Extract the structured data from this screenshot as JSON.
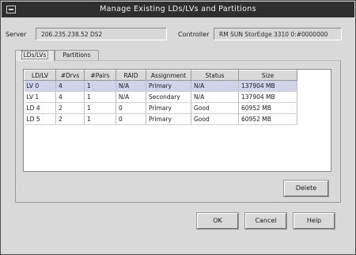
{
  "window": {
    "title": "Manage Existing LDs/LVs and Partitions"
  },
  "server": {
    "label": "Server",
    "value": "206.235.238.52 DS2"
  },
  "controller": {
    "label": "Controller",
    "value": "RM SUN StorEdge 3310 0:#0000000"
  },
  "tabs": [
    {
      "label": "LDs/LVs",
      "active": true
    },
    {
      "label": "Partitions",
      "active": false
    }
  ],
  "table": {
    "columns": [
      "LD/LV",
      "#Drvs",
      "#Pairs",
      "RAID",
      "Assignment",
      "Status",
      "Size"
    ],
    "rows": [
      [
        "LV 0",
        "4",
        "1",
        "N/A",
        "Primary",
        "N/A",
        "137904 MB"
      ],
      [
        "LV 1",
        "4",
        "1",
        "N/A",
        "Secondary",
        "N/A",
        "137904 MB"
      ],
      [
        "LD 4",
        "2",
        "1",
        "0",
        "Primary",
        "Good",
        "60952 MB"
      ],
      [
        "LD 5",
        "2",
        "1",
        "0",
        "Primary",
        "Good",
        "60952 MB"
      ]
    ],
    "selected_row": 0
  },
  "buttons": {
    "delete": "Delete",
    "ok": "OK",
    "cancel": "Cancel",
    "help": "Help"
  },
  "colors": {
    "titlebar": "#2f2f2f",
    "window_bg": "#d9d9d9",
    "selection": "#cfd4ea"
  }
}
